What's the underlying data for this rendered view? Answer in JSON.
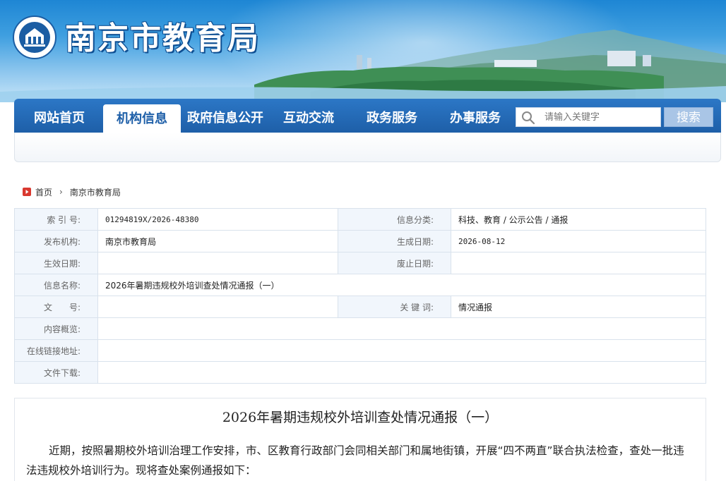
{
  "site": {
    "title": "南京市教育局"
  },
  "nav": {
    "items": [
      {
        "label": "网站首页",
        "active": false
      },
      {
        "label": "机构信息",
        "active": true
      },
      {
        "label": "政府信息公开",
        "active": false
      },
      {
        "label": "互动交流",
        "active": false
      },
      {
        "label": "政务服务",
        "active": false
      },
      {
        "label": "办事服务",
        "active": false
      }
    ],
    "search_placeholder": "请输入关键字",
    "search_button": "搜索"
  },
  "breadcrumb": {
    "home": "首页",
    "current": "南京市教育局"
  },
  "info": {
    "index_label": "索 引 号:",
    "index_value": "01294819X/2026-48380",
    "category_label": "信息分类:",
    "category_value": "科技、教育 / 公示公告 / 通报",
    "publisher_label": "发布机构:",
    "publisher_value": "南京市教育局",
    "created_label": "生成日期:",
    "created_value": "2026-08-12",
    "effective_label": "生效日期:",
    "effective_value": "",
    "repeal_label": "废止日期:",
    "repeal_value": "",
    "name_label": "信息名称:",
    "name_value": "2026年暑期违规校外培训查处情况通报（一）",
    "doc_no_label": "文　　号:",
    "doc_no_value": "",
    "keyword_label": "关 键 词:",
    "keyword_value": "情况通报",
    "summary_label": "内容概览:",
    "summary_value": "",
    "link_label": "在线链接地址:",
    "link_value": "",
    "download_label": "文件下载:",
    "download_value": ""
  },
  "article": {
    "title": "2026年暑期违规校外培训查处情况通报（一）",
    "body": "近期，按照暑期校外培训治理工作安排，市、区教育行政部门会同相关部门和属地街镇，开展“四不两直”联合执法检查，查处一批违法违规校外培训行为。现将查处案例通报如下："
  },
  "colors": {
    "nav_blue": "#1e5fa8",
    "label_bg": "#f1f6fc",
    "home_icon_red": "#d9382f"
  }
}
